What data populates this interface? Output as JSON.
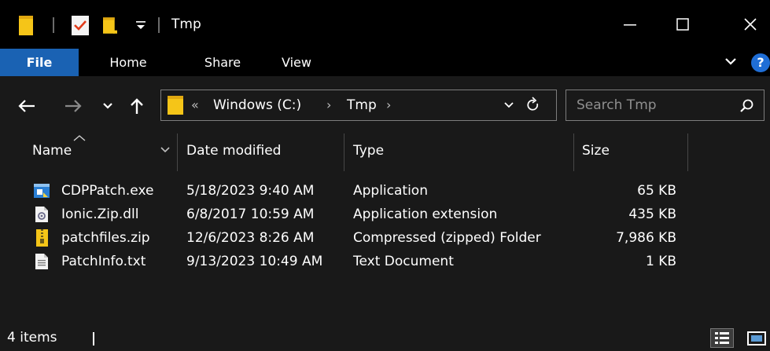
{
  "window": {
    "title": "Tmp",
    "controls": [
      "minimize-icon",
      "maximize-icon",
      "close-icon"
    ]
  },
  "quick_access": [
    "folder-icon",
    "properties-icon",
    "new-folder-icon",
    "customize-dropdown-icon"
  ],
  "ribbon": {
    "tabs": [
      "File",
      "Home",
      "Share",
      "View"
    ],
    "help_label": "?"
  },
  "nav": {
    "address": {
      "overflow": "«",
      "segments": [
        "Windows (C:)",
        "Tmp"
      ],
      "separator": "›"
    },
    "search": {
      "placeholder": "Search Tmp"
    }
  },
  "columns": {
    "name": "Name",
    "date": "Date modified",
    "type": "Type",
    "size": "Size"
  },
  "files": [
    {
      "name": "CDPPatch.exe",
      "date": "5/18/2023 9:40 AM",
      "type": "Application",
      "size": "65 KB",
      "icon": "application-icon"
    },
    {
      "name": "Ionic.Zip.dll",
      "date": "6/8/2017 10:59 AM",
      "type": "Application extension",
      "size": "435 KB",
      "icon": "dll-icon"
    },
    {
      "name": "patchfiles.zip",
      "date": "12/6/2023 8:26 AM",
      "type": "Compressed (zipped) Folder",
      "size": "7,986 KB",
      "icon": "zip-folder-icon"
    },
    {
      "name": "PatchInfo.txt",
      "date": "9/13/2023 10:49 AM",
      "type": "Text Document",
      "size": "1 KB",
      "icon": "text-document-icon"
    }
  ],
  "status": {
    "item_count": "4 items"
  },
  "colors": {
    "titlebar_bg": "#000000",
    "body_bg": "#191919",
    "file_tab": "#1a62b3",
    "folder_yellow": "#f5c518",
    "help_blue": "#1f6ed6"
  }
}
